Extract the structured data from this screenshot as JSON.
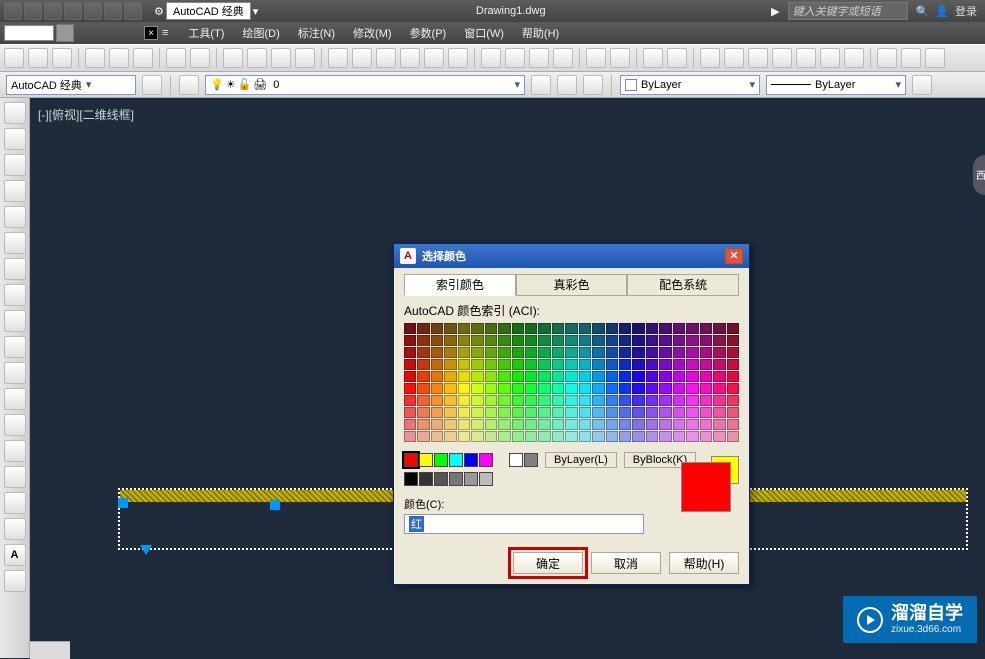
{
  "titlebar": {
    "workspace_label": "AutoCAD 经典",
    "doc_title": "Drawing1.dwg",
    "search_placeholder": "键入关键字或短语",
    "login_label": "登录"
  },
  "menu": {
    "items": [
      "工具(T)",
      "绘图(D)",
      "标注(N)",
      "修改(M)",
      "参数(P)",
      "窗口(W)",
      "帮助(H)"
    ]
  },
  "toolbar2": {
    "workspace": "AutoCAD 经典",
    "layer_current": "0",
    "bylayer": "ByLayer",
    "linetype": "ByLayer"
  },
  "viewport": {
    "label": "[-][俯视][二维线框]"
  },
  "dialog": {
    "title": "选择颜色",
    "tabs": [
      "索引颜色",
      "真彩色",
      "配色系统"
    ],
    "aci_label": "AutoCAD 颜色索引 (ACI):",
    "bylayer_btn": "ByLayer(L)",
    "byblock_btn": "ByBlock(K)",
    "color_label": "颜色(C):",
    "color_value": "红",
    "ok": "确定",
    "cancel": "取消",
    "help": "帮助(H)",
    "basic_colors": [
      "#ff0000",
      "#ffff00",
      "#00ff00",
      "#00ffff",
      "#0000ff",
      "#ff00ff"
    ],
    "neutral_colors": [
      "#ffffff",
      "#808080"
    ],
    "gray_row": [
      "#000000",
      "#333333",
      "#555555",
      "#777777",
      "#999999",
      "#bbbbbb"
    ],
    "aci_palette_rows": 10,
    "aci_palette_cols": 25
  },
  "watermark": {
    "main": "溜溜自学",
    "sub": "zixue.3d66.com"
  },
  "right_fragment": "西"
}
